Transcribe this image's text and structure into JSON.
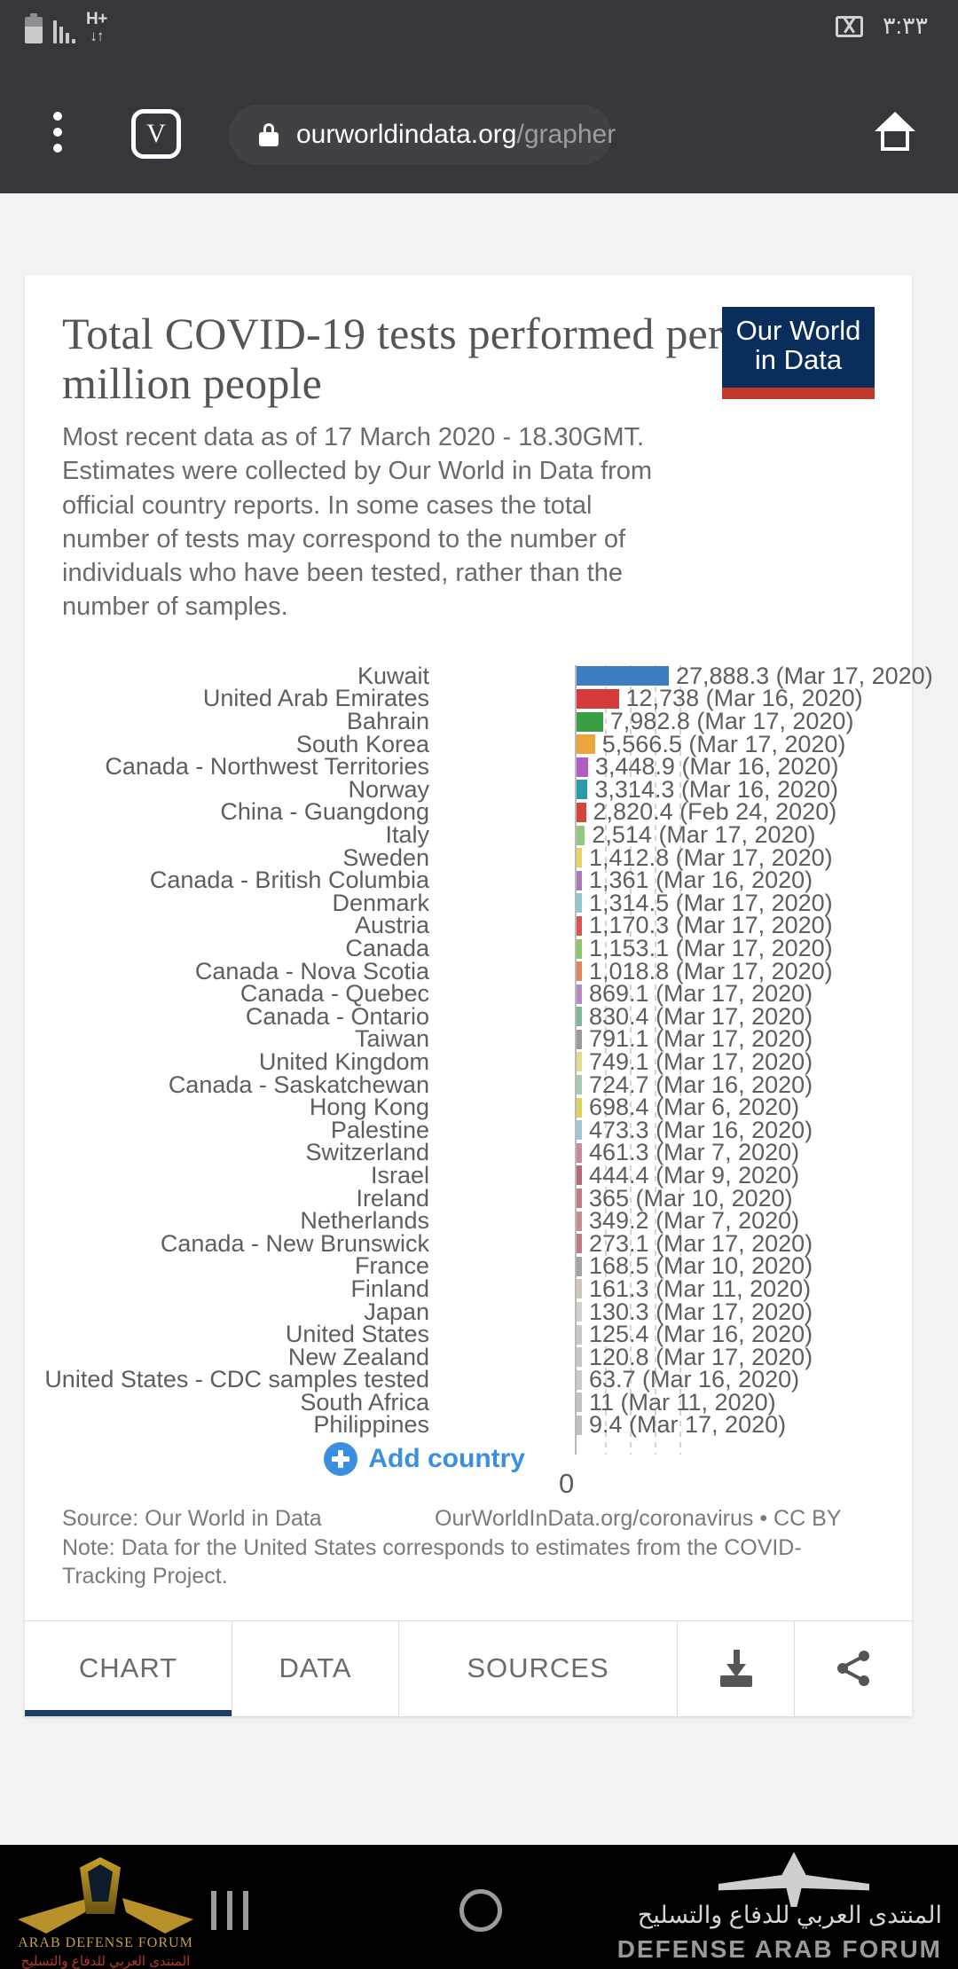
{
  "statusbar": {
    "time": "٣:٣٣",
    "icons": [
      "battery-icon",
      "signal-icon",
      "hplus-data-icon",
      "gmail-icon"
    ],
    "hplus_label": "H+",
    "hplus_arrows": "↓↑"
  },
  "browser": {
    "menu_icon": "kebab-menu-icon",
    "tab_badge": "V",
    "lock_icon": "lock-icon",
    "url_domain": "ourworldindata.org",
    "url_path": "/grapher",
    "home_icon": "home-icon"
  },
  "logo": {
    "line1": "Our World",
    "line2": "in Data",
    "bg": "#0a2e5c",
    "accent": "#c0392b"
  },
  "chart": {
    "title": "Total COVID-19 tests performed per million people",
    "subtitle": "Most recent data as of 17 March 2020 - 18.30GMT. Estimates were collected by Our World in Data from official country reports. In some cases the total number of tests may correspond to the number of individuals who have been tested, rather than the number of samples.",
    "add_country_label": "Add country",
    "add_country_icon": "plus-circle-icon",
    "axis_zero": "0"
  },
  "footer": {
    "source": "Source: Our World in Data",
    "license": "OurWorldInData.org/coronavirus • CC BY",
    "note": "Note: Data for the United States corresponds to estimates from the COVID-Tracking Project."
  },
  "tabs": [
    {
      "label": "CHART",
      "active": true
    },
    {
      "label": "DATA",
      "active": false
    },
    {
      "label": "SOURCES",
      "active": false
    }
  ],
  "tab_icons": [
    {
      "name": "download-icon"
    },
    {
      "name": "share-icon"
    }
  ],
  "navbar": {
    "recents_icon": "recents-icon",
    "home_icon": "home-circle-icon",
    "watermark_left_en": "ARAB DEFENSE FORUM",
    "watermark_left_ar": "المنتدى العربي للدفاع والتسليح",
    "watermark_right_ar": "المنتدى العربي للدفاع والتسليح",
    "watermark_right_en": "DEFENSE ARAB FORUM"
  },
  "chart_data": {
    "type": "bar",
    "title": "Total COVID-19 tests performed per million people",
    "subtitle": "Most recent data as of 17 March 2020 - 18.30GMT.",
    "orientation": "horizontal",
    "xlabel": "",
    "ylabel": "",
    "xlim": [
      0,
      27888.3
    ],
    "axis_ticks": [
      "0"
    ],
    "grid": true,
    "legend": "none",
    "categories": [
      "Kuwait",
      "United Arab Emirates",
      "Bahrain",
      "South Korea",
      "Canada - Northwest Territories",
      "Norway",
      "China - Guangdong",
      "Italy",
      "Sweden",
      "Canada - British Columbia",
      "Denmark",
      "Austria",
      "Canada",
      "Canada - Nova Scotia",
      "Canada - Quebec",
      "Canada - Ontario",
      "Taiwan",
      "United Kingdom",
      "Canada - Saskatchewan",
      "Hong Kong",
      "Palestine",
      "Switzerland",
      "Israel",
      "Ireland",
      "Netherlands",
      "Canada - New Brunswick",
      "France",
      "Finland",
      "Japan",
      "United States",
      "New Zealand",
      "United States - CDC samples tested",
      "South Africa",
      "Philippines"
    ],
    "values": [
      27888.3,
      12738,
      7982.8,
      5566.5,
      3448.9,
      3314.3,
      2820.4,
      2514,
      1412.8,
      1361,
      1314.5,
      1170.3,
      1153.1,
      1018.8,
      869.1,
      830.4,
      791.1,
      749.1,
      724.7,
      698.4,
      473.3,
      461.3,
      444.4,
      365,
      349.2,
      273.1,
      168.5,
      161.3,
      130.3,
      125.4,
      120.8,
      63.7,
      11,
      9.4
    ],
    "value_labels": [
      "27,888.3 (Mar 17, 2020)",
      "12,738 (Mar 16, 2020)",
      "7,982.8 (Mar 17, 2020)",
      "5,566.5 (Mar 17, 2020)",
      "3,448.9 (Mar 16, 2020)",
      "3,314.3 (Mar 16, 2020)",
      "2,820.4 (Feb 24, 2020)",
      "2,514 (Mar 17, 2020)",
      "1,412.8 (Mar 17, 2020)",
      "1,361 (Mar 16, 2020)",
      "1,314.5 (Mar 17, 2020)",
      "1,170.3 (Mar 17, 2020)",
      "1,153.1 (Mar 17, 2020)",
      "1,018.8 (Mar 17, 2020)",
      "869.1 (Mar 17, 2020)",
      "830.4 (Mar 17, 2020)",
      "791.1 (Mar 17, 2020)",
      "749.1 (Mar 17, 2020)",
      "724.7 (Mar 16, 2020)",
      "698.4 (Mar 6, 2020)",
      "473.3 (Mar 16, 2020)",
      "461.3 (Mar 7, 2020)",
      "444.4 (Mar 9, 2020)",
      "365 (Mar 10, 2020)",
      "349.2 (Mar 7, 2020)",
      "273.1 (Mar 17, 2020)",
      "168.5 (Mar 10, 2020)",
      "161.3 (Mar 11, 2020)",
      "130.3 (Mar 17, 2020)",
      "125.4 (Mar 16, 2020)",
      "120.8 (Mar 17, 2020)",
      "63.7 (Mar 16, 2020)",
      "11 (Mar 11, 2020)",
      "9.4 (Mar 17, 2020)"
    ],
    "dates": [
      "Mar 17, 2020",
      "Mar 16, 2020",
      "Mar 17, 2020",
      "Mar 17, 2020",
      "Mar 16, 2020",
      "Mar 16, 2020",
      "Feb 24, 2020",
      "Mar 17, 2020",
      "Mar 17, 2020",
      "Mar 16, 2020",
      "Mar 17, 2020",
      "Mar 17, 2020",
      "Mar 17, 2020",
      "Mar 17, 2020",
      "Mar 17, 2020",
      "Mar 17, 2020",
      "Mar 17, 2020",
      "Mar 17, 2020",
      "Mar 16, 2020",
      "Mar 6, 2020",
      "Mar 16, 2020",
      "Mar 7, 2020",
      "Mar 9, 2020",
      "Mar 10, 2020",
      "Mar 7, 2020",
      "Mar 17, 2020",
      "Mar 10, 2020",
      "Mar 11, 2020",
      "Mar 17, 2020",
      "Mar 16, 2020",
      "Mar 17, 2020",
      "Mar 16, 2020",
      "Mar 11, 2020",
      "Mar 17, 2020"
    ],
    "colors": [
      "#3c7dc4",
      "#d63b3b",
      "#3a9e45",
      "#eda63b",
      "#b05ec4",
      "#2a9aa8",
      "#d6453c",
      "#93c97f",
      "#e8d166",
      "#a878b8",
      "#8fc6cf",
      "#d9534f",
      "#8cc46a",
      "#e0845c",
      "#b88ac4",
      "#7fb89a",
      "#9a9a9a",
      "#e3dc8a",
      "#a8cbb0",
      "#dcd45a",
      "#9fc4d4",
      "#c68a9a",
      "#b56878",
      "#c07a88",
      "#c98a98",
      "#bd7a8a",
      "#a8a2a0",
      "#cfc8bd",
      "#cfd0cb",
      "#c9cac7",
      "#c4c8c9",
      "#c9cbc7",
      "#c2c4c0",
      "#bfc1bd"
    ]
  }
}
